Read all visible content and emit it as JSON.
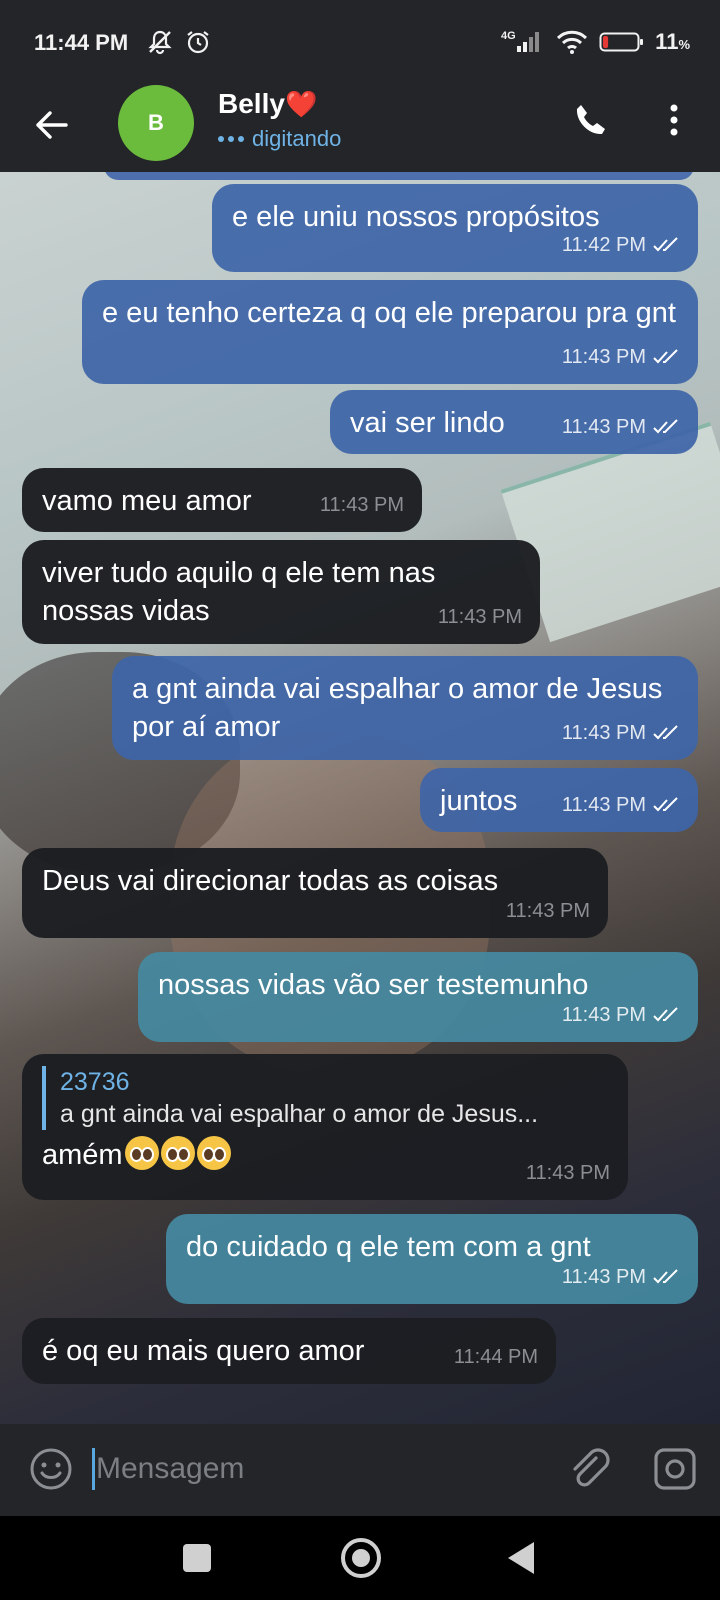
{
  "status_bar": {
    "time": "11:44 PM",
    "network": "4G",
    "battery_text": "11",
    "battery_unit": "%",
    "battery_level": 0.11,
    "icons": [
      "mute-icon",
      "alarm-icon",
      "signal-icon",
      "wifi-icon",
      "battery-icon"
    ]
  },
  "header": {
    "avatar_initial": "B",
    "avatar_color": "#6bbb3d",
    "contact_name": "Belly",
    "contact_emoji": "❤️",
    "status": "digitando",
    "icons": [
      "back-arrow-icon",
      "phone-icon",
      "more-vert-icon"
    ]
  },
  "messages": [
    {
      "text": "e ele uniu nossos propósitos",
      "time": "11:42 PM",
      "outgoing": true,
      "read": true
    },
    {
      "text": "e eu tenho certeza q oq ele preparou pra gnt",
      "time": "11:43 PM",
      "outgoing": true,
      "read": true
    },
    {
      "text": "vai ser lindo",
      "time": "11:43 PM",
      "outgoing": true,
      "read": true
    },
    {
      "text": "vamo meu amor",
      "time": "11:43 PM",
      "outgoing": false
    },
    {
      "text": "viver tudo aquilo q ele tem nas nossas vidas",
      "time": "11:43 PM",
      "outgoing": false
    },
    {
      "text": "a gnt ainda vai espalhar o amor de Jesus por aí amor",
      "time": "11:43 PM",
      "outgoing": true,
      "read": true
    },
    {
      "text": "juntos",
      "time": "11:43 PM",
      "outgoing": true,
      "read": true
    },
    {
      "text": "Deus vai direcionar todas as coisas",
      "time": "11:43 PM",
      "outgoing": false
    },
    {
      "text": "nossas vidas vão ser testemunho",
      "time": "11:43 PM",
      "outgoing": true,
      "read": true
    },
    {
      "reply_author": "23736",
      "reply_text": "a gnt ainda vai espalhar o amor de Jesus...",
      "text": "amém",
      "emoji": "🥺🥺🥺",
      "time": "11:43 PM",
      "outgoing": false
    },
    {
      "text": "do cuidado q ele tem com a gnt",
      "time": "11:43 PM",
      "outgoing": true,
      "read": true
    },
    {
      "text": "é oq eu mais quero amor",
      "time": "11:44 PM",
      "outgoing": false
    }
  ],
  "input": {
    "placeholder": "Mensagem",
    "value": "",
    "icons": [
      "emoji-icon",
      "paperclip-icon",
      "camera-icon"
    ]
  },
  "nav_bar": {
    "icons": [
      "recents-icon",
      "home-icon",
      "back-icon"
    ]
  },
  "colors": {
    "outgoing_bubble": "#3e65a8",
    "outgoing_bubble_teal": "#4589a0",
    "incoming_bubble": "#1c1e22",
    "accent": "#6fb3e6",
    "bar_background": "#232528"
  }
}
